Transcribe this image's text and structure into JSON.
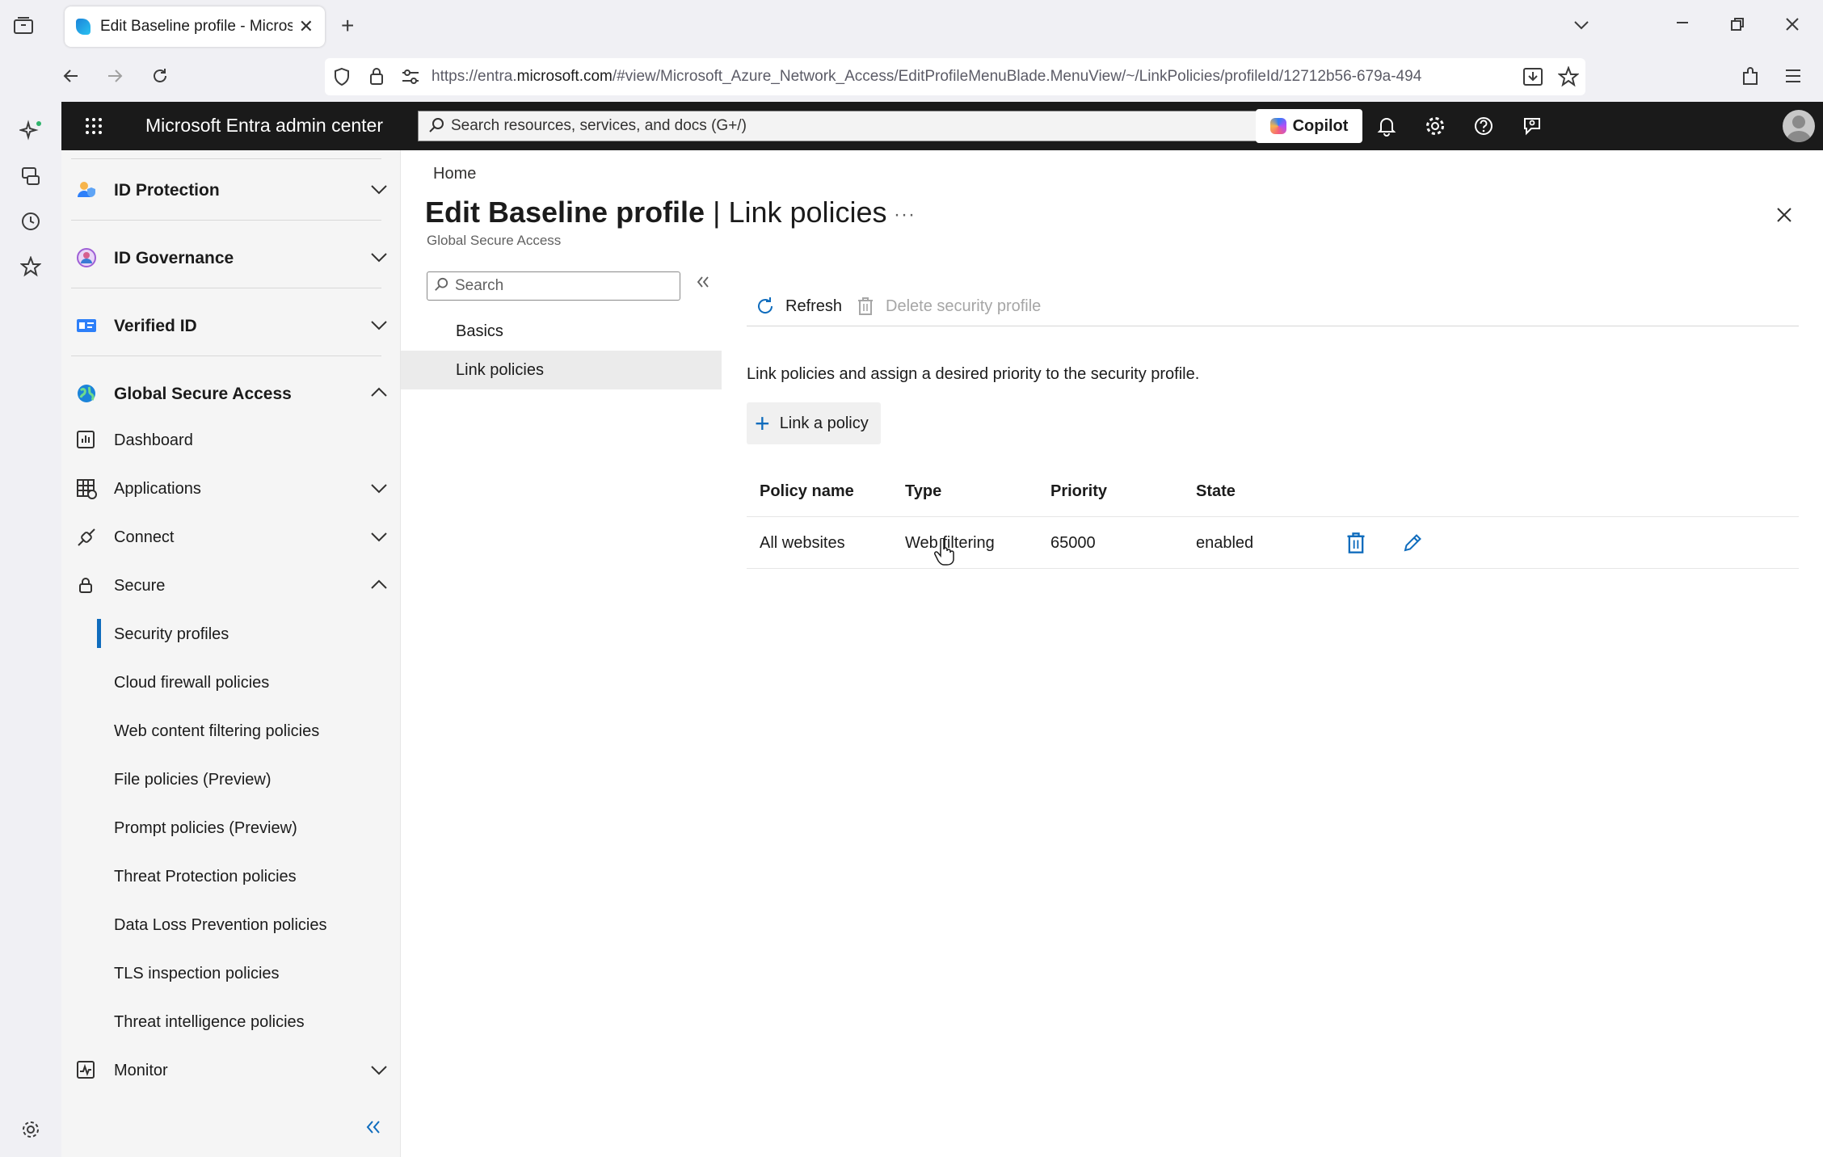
{
  "browser": {
    "tab_title": "Edit Baseline profile - Microsoft",
    "url_prefix": "https://entra.",
    "url_domain": "microsoft.com",
    "url_rest": "/#view/Microsoft_Azure_Network_Access/EditProfileMenuBlade.MenuView/~/LinkPolicies/profileId/12712b56-679a-494"
  },
  "header": {
    "brand": "Microsoft Entra admin center",
    "search_placeholder": "Search resources, services, and docs (G+/)",
    "copilot_label": "Copilot"
  },
  "leftnav": {
    "groups": [
      {
        "label": "ID Protection"
      },
      {
        "label": "ID Governance"
      },
      {
        "label": "Verified ID"
      },
      {
        "label": "Global Secure Access"
      }
    ],
    "items": [
      {
        "label": "Dashboard"
      },
      {
        "label": "Applications"
      },
      {
        "label": "Connect"
      },
      {
        "label": "Secure"
      }
    ],
    "secure_sub": [
      {
        "label": "Security profiles"
      },
      {
        "label": "Cloud firewall policies"
      },
      {
        "label": "Web content filtering policies"
      },
      {
        "label": "File policies (Preview)"
      },
      {
        "label": "Prompt policies (Preview)"
      },
      {
        "label": "Threat Protection policies"
      },
      {
        "label": "Data Loss Prevention policies"
      },
      {
        "label": "TLS inspection policies"
      },
      {
        "label": "Threat intelligence policies"
      }
    ],
    "monitor_label": "Monitor"
  },
  "page": {
    "breadcrumb": "Home",
    "title_main": "Edit Baseline profile",
    "title_sep": " | ",
    "title_sub": "Link policies",
    "more": "···",
    "subtitle": "Global Secure Access",
    "search_placeholder": "Search",
    "menu": [
      {
        "label": "Basics"
      },
      {
        "label": "Link policies"
      }
    ],
    "cmd_refresh": "Refresh",
    "cmd_delete": "Delete security profile",
    "description": "Link policies and assign a desired priority to the security profile.",
    "link_button": "Link a policy",
    "table": {
      "headers": [
        "Policy name",
        "Type",
        "Priority",
        "State"
      ],
      "rows": [
        {
          "name": "All websites",
          "type": "Web filtering",
          "priority": "65000",
          "state": "enabled"
        }
      ]
    }
  },
  "colors": {
    "accent": "#0f6cbd",
    "topbar": "#1a1a1a"
  }
}
